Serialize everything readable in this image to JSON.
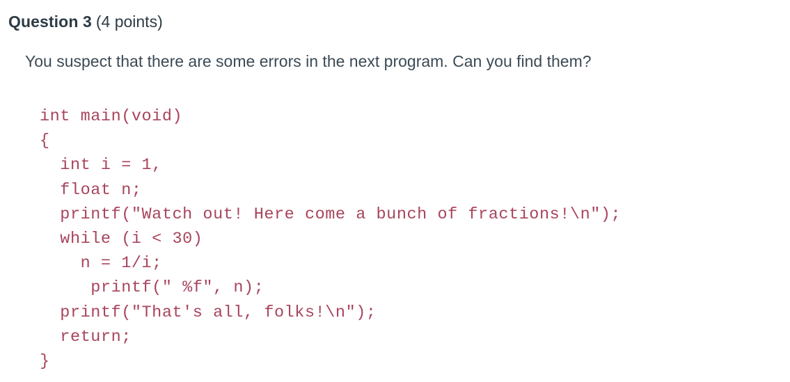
{
  "header": {
    "title": "Question 3",
    "points": "(4 points)"
  },
  "prompt": {
    "text": "You suspect that there are some errors in the next program. Can you find them?"
  },
  "code": {
    "language": "c",
    "color": "#a8445c",
    "lines": [
      "int main(void)",
      "{",
      "  int i = 1,",
      "  float n;",
      "  printf(\"Watch out! Here come a bunch of fractions!\\n\");",
      "  while (i < 30)",
      "    n = 1/i;",
      "     printf(\" %f\", n);",
      "  printf(\"That's all, folks!\\n\");",
      "  return;",
      "}"
    ]
  },
  "colors": {
    "text": "#2d3b45",
    "prompt_text": "#3b4a55",
    "code_text": "#a8445c",
    "background": "#ffffff"
  }
}
